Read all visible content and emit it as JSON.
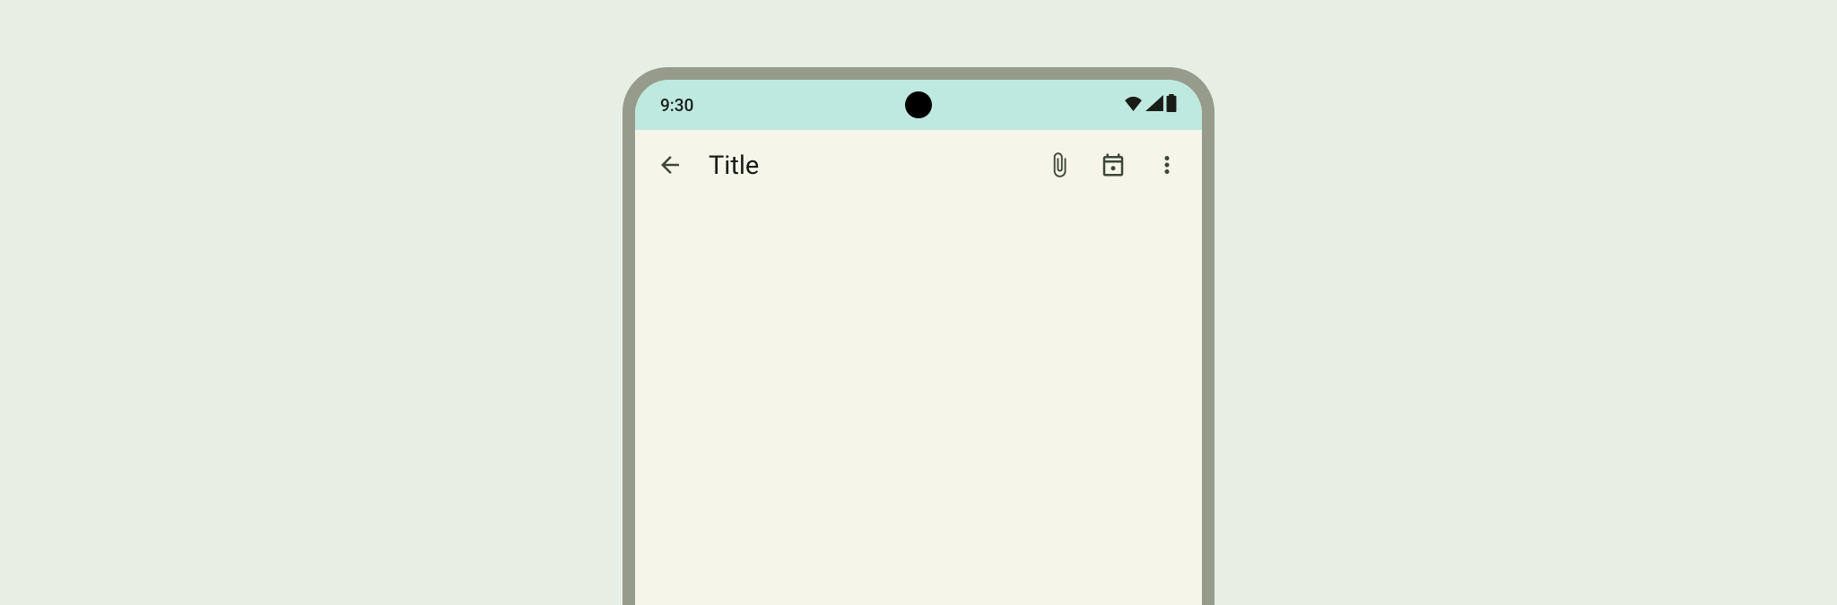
{
  "statusBar": {
    "time": "9:30"
  },
  "appBar": {
    "title": "Title",
    "icons": {
      "back": "back-arrow-icon",
      "attach": "attach-file-icon",
      "calendar": "calendar-event-icon",
      "more": "more-vert-icon"
    }
  }
}
